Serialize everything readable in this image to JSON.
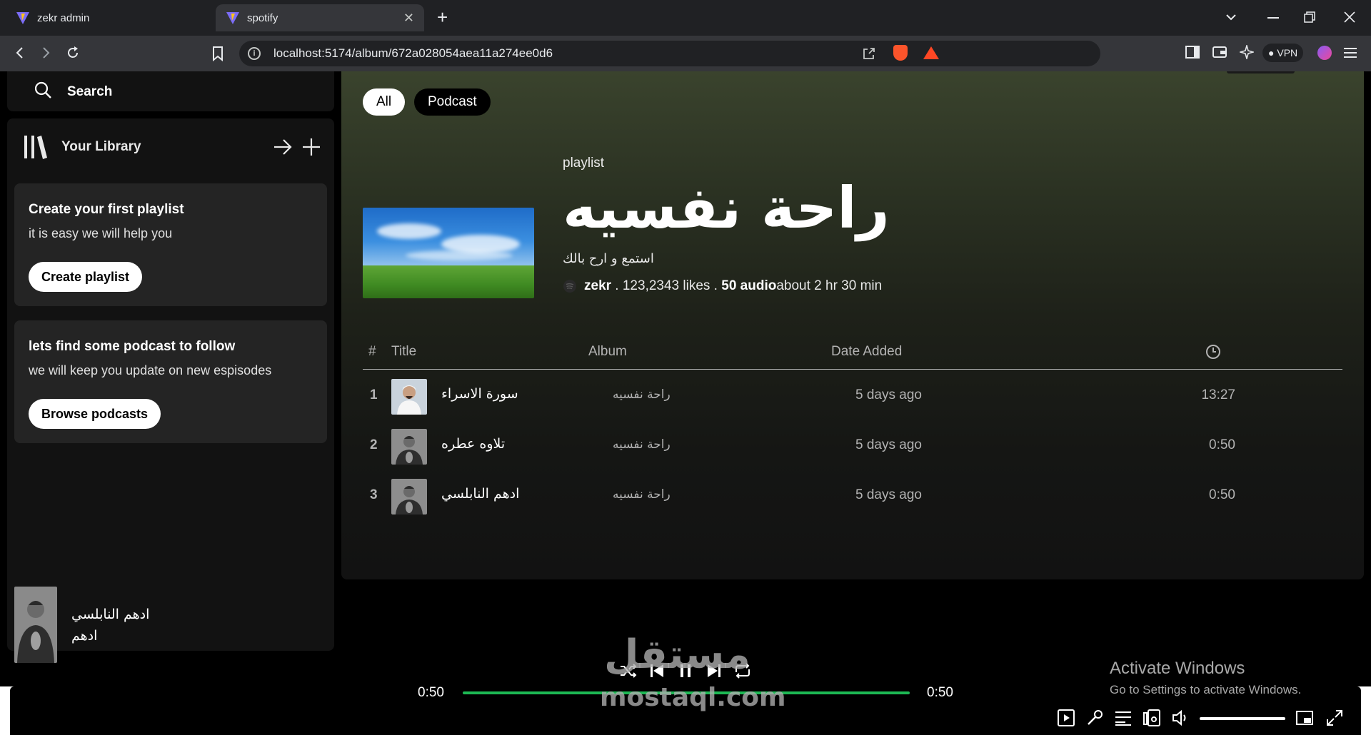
{
  "browser": {
    "tabs": [
      {
        "title": "zekr admin",
        "active": false
      },
      {
        "title": "spotify",
        "active": true
      }
    ],
    "url": "localhost:5174/album/672a028054aea11a274ee0d6",
    "vpn_label": "VPN"
  },
  "sidebar": {
    "search_label": "Search",
    "library_label": "Your Library",
    "cards": [
      {
        "title": "Create your first playlist",
        "subtitle": "it is easy we will help you",
        "button": "Create playlist"
      },
      {
        "title": "lets find some podcast to follow",
        "subtitle": "we will keep you update on new espisodes",
        "button": "Browse podcasts"
      }
    ]
  },
  "filters": [
    "All",
    "Podcast"
  ],
  "playlist": {
    "type": "playlist",
    "title": "راحة نفسيه",
    "description": "استمع و ارح بالك",
    "owner": "zekr",
    "likes": " . 123,2343 likes . ",
    "count": "50 audio",
    "duration": "about 2 hr 30 min"
  },
  "table": {
    "headers": {
      "num": "#",
      "title": "Title",
      "album": "Album",
      "date": "Date Added"
    },
    "rows": [
      {
        "num": "1",
        "title": "سورة الاسراء",
        "album": "راحة نفسيه",
        "date": "5 days ago",
        "duration": "13:27"
      },
      {
        "num": "2",
        "title": "تلاوه عطره",
        "album": "راحة نفسيه",
        "date": "5 days ago",
        "duration": "0:50"
      },
      {
        "num": "3",
        "title": "ادهم النابلسي",
        "album": "راحة نفسيه",
        "date": "5 days ago",
        "duration": "0:50"
      }
    ]
  },
  "player": {
    "title": "ادهم النابلسي",
    "artist": "ادهم",
    "current_time": "0:50",
    "total_time": "0:50",
    "progress": 1.0,
    "volume": 1.0
  },
  "watermark": {
    "arabic": "مستقل",
    "latin": "mostaql.com"
  },
  "os_notice": {
    "title": "Activate Windows",
    "subtitle": "Go to Settings to activate Windows."
  },
  "colors": {
    "accent": "#1db954",
    "panel": "#121212",
    "card": "#242424"
  }
}
